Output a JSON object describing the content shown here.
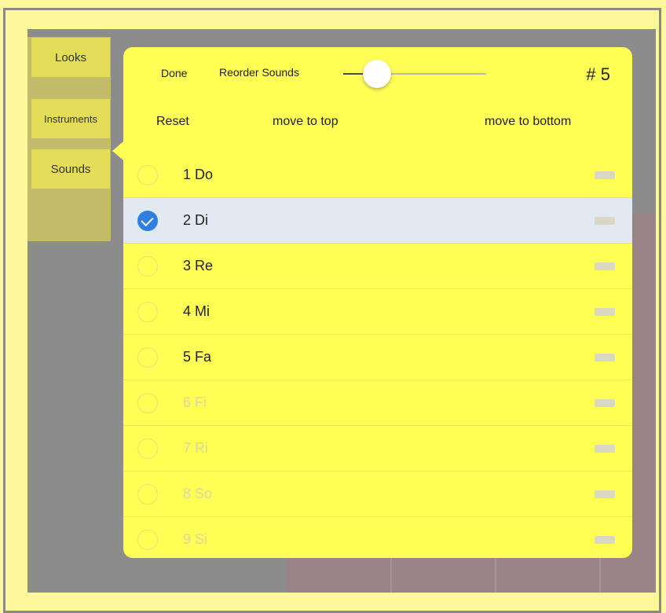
{
  "side_tabs": [
    {
      "label": "Looks"
    },
    {
      "label": "Instruments"
    },
    {
      "label": "Sounds"
    }
  ],
  "header": {
    "done_label": "Done",
    "title": "Reorder Sounds",
    "count": "# 5",
    "slider_value": 0.15
  },
  "actions": {
    "reset": "Reset",
    "move_top": "move to top",
    "move_bottom": "move to bottom"
  },
  "sounds": [
    {
      "label": "1 Do",
      "selected": false,
      "dim": false
    },
    {
      "label": "2 Di",
      "selected": true,
      "dim": false
    },
    {
      "label": "3 Re",
      "selected": false,
      "dim": false
    },
    {
      "label": "4 Mi",
      "selected": false,
      "dim": false
    },
    {
      "label": "5 Fa",
      "selected": false,
      "dim": false
    },
    {
      "label": "6 Fi",
      "selected": false,
      "dim": true
    },
    {
      "label": "7 Ri",
      "selected": false,
      "dim": true
    },
    {
      "label": "8 So",
      "selected": false,
      "dim": true
    },
    {
      "label": "9 Si",
      "selected": false,
      "dim": true
    }
  ],
  "colors": {
    "popover_bg": "#ffff55",
    "selected_row_bg": "#e3e9f2",
    "check_blue": "#2f7fe0"
  }
}
